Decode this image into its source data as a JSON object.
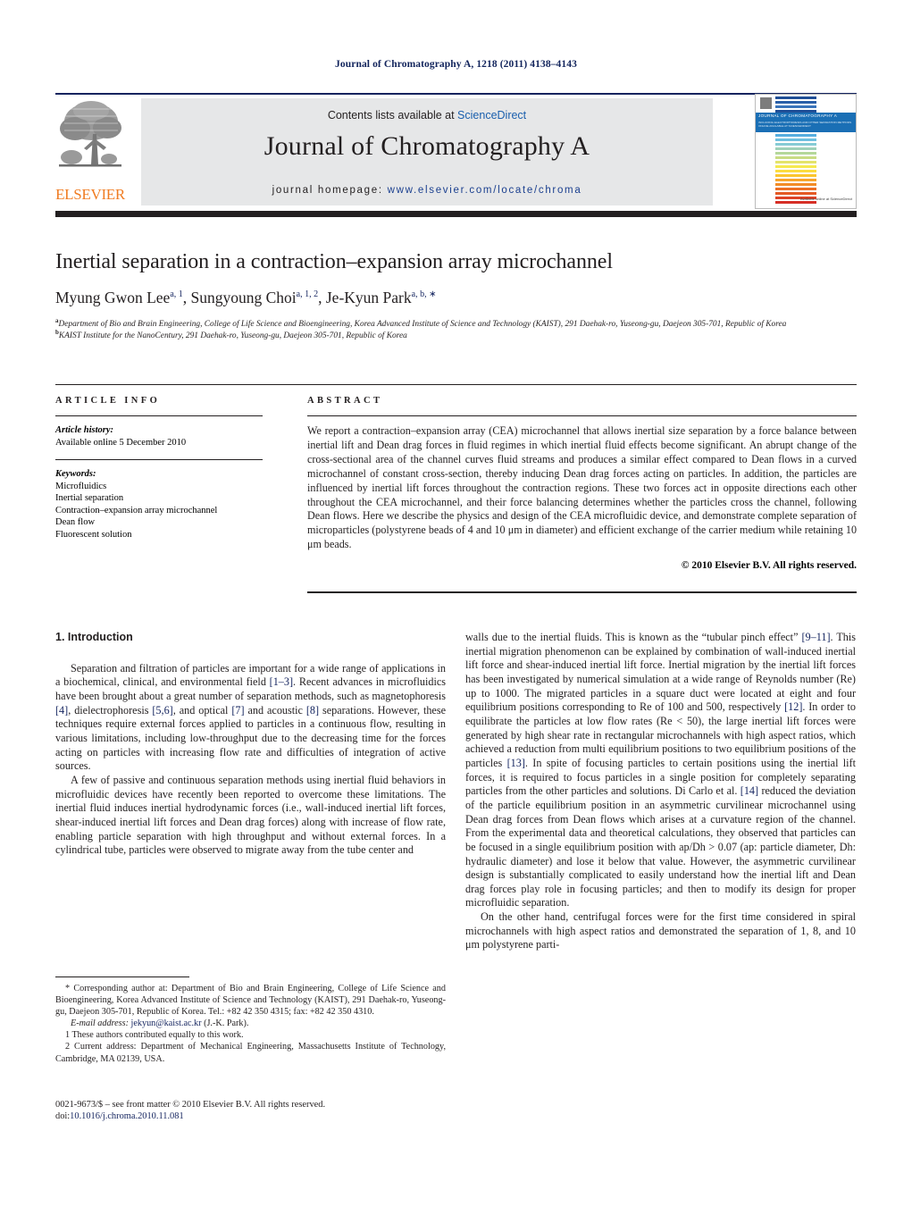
{
  "running_head": "Journal of Chromatography A, 1218 (2011) 4138–4143",
  "masthead": {
    "contents_prefix": "Contents lists available at ",
    "sciencedirect": "ScienceDirect",
    "journal_title": "Journal of Chromatography A",
    "homepage_prefix": "journal homepage: ",
    "homepage_url": "www.elsevier.com/locate/chroma",
    "publisher": "ELSEVIER",
    "cover": {
      "banner_title": "JOURNAL OF CHROMATOGRAPHY A",
      "banner_sub": "INCLUDING ELECTROPHORESIS AND OTHER SEPARATION METHODS\nONLINE AVAILABLE AT SCIENCEDIRECT",
      "sciencedirect_note": "Available online at\nScienceDirect"
    }
  },
  "title": "Inertial separation in a contraction–expansion array microchannel",
  "authors": [
    {
      "name": "Myung Gwon Lee",
      "sup": "a, 1"
    },
    {
      "name": "Sungyoung Choi",
      "sup": "a, 1, 2"
    },
    {
      "name": "Je-Kyun Park",
      "sup": "a, b, ∗"
    }
  ],
  "affiliations": [
    {
      "marker": "a",
      "text": "Department of Bio and Brain Engineering, College of Life Science and Bioengineering, Korea Advanced Institute of Science and Technology (KAIST), 291 Daehak-ro, Yuseong-gu, Daejeon 305-701, Republic of Korea"
    },
    {
      "marker": "b",
      "text": "KAIST Institute for the NanoCentury, 291 Daehak-ro, Yuseong-gu, Daejeon 305-701, Republic of Korea"
    }
  ],
  "article_info": {
    "heading": "ARTICLE INFO",
    "history_label": "Article history:",
    "history_value": "Available online 5 December 2010",
    "keywords_label": "Keywords:",
    "keywords": [
      "Microfluidics",
      "Inertial separation",
      "Contraction–expansion array microchannel",
      "Dean flow",
      "Fluorescent solution"
    ]
  },
  "abstract": {
    "heading": "ABSTRACT",
    "body": "We report a contraction–expansion array (CEA) microchannel that allows inertial size separation by a force balance between inertial lift and Dean drag forces in fluid regimes in which inertial fluid effects become significant. An abrupt change of the cross-sectional area of the channel curves fluid streams and produces a similar effect compared to Dean flows in a curved microchannel of constant cross-section, thereby inducing Dean drag forces acting on particles. In addition, the particles are influenced by inertial lift forces throughout the contraction regions. These two forces act in opposite directions each other throughout the CEA microchannel, and their force balancing determines whether the particles cross the channel, following Dean flows. Here we describe the physics and design of the CEA microfluidic device, and demonstrate complete separation of microparticles (polystyrene beads of 4 and 10 μm in diameter) and efficient exchange of the carrier medium while retaining 10 μm beads.",
    "copyright": "© 2010 Elsevier B.V. All rights reserved."
  },
  "section_heading": "1. Introduction",
  "left_column": {
    "p1_a": "Separation and filtration of particles are important for a wide range of applications in a biochemical, clinical, and environmental field ",
    "p1_c1": "[1–3]",
    "p1_b": ". Recent advances in microfluidics have been brought about a great number of separation methods, such as magnetophoresis ",
    "p1_c2": "[4]",
    "p1_c": ", dielectrophoresis ",
    "p1_c3": "[5,6]",
    "p1_d": ", and optical ",
    "p1_c4": "[7]",
    "p1_e": " and acoustic ",
    "p1_c5": "[8]",
    "p1_f": " separations. However, these techniques require external forces applied to particles in a continuous flow, resulting in various limitations, including low-throughput due to the decreasing time for the forces acting on particles with increasing flow rate and difficulties of integration of active sources.",
    "p2": "A few of passive and continuous separation methods using inertial fluid behaviors in microfluidic devices have recently been reported to overcome these limitations. The inertial fluid induces inertial hydrodynamic forces (i.e., wall-induced inertial lift forces, shear-induced inertial lift forces and Dean drag forces) along with increase of flow rate, enabling particle separation with high throughput and without external forces. In a cylindrical tube, particles were observed to migrate away from the tube center and"
  },
  "right_column": {
    "p1_a": "walls due to the inertial fluids. This is known as the “tubular pinch effect” ",
    "p1_c1": "[9–11]",
    "p1_b": ". This inertial migration phenomenon can be explained by combination of wall-induced inertial lift force and shear-induced inertial lift force. Inertial migration by the inertial lift forces has been investigated by numerical simulation at a wide range of Reynolds number (Re) up to 1000. The migrated particles in a square duct were located at eight and four equilibrium positions corresponding to Re of 100 and 500, respectively ",
    "p1_c2": "[12]",
    "p1_c": ". In order to equilibrate the particles at low flow rates (Re < 50), the large inertial lift forces were generated by high shear rate in rectangular microchannels with high aspect ratios, which achieved a reduction from multi equilibrium positions to two equilibrium positions of the particles ",
    "p1_c3": "[13]",
    "p1_d": ". In spite of focusing particles to certain positions using the inertial lift forces, it is required to focus particles in a single position for completely separating particles from the other particles and solutions. Di Carlo et al. ",
    "p1_c4": "[14]",
    "p1_e": " reduced the deviation of the particle equilibrium position in an asymmetric curvilinear microchannel using Dean drag forces from Dean flows which arises at a curvature region of the channel. From the experimental data and theoretical calculations, they observed that particles can be focused in a single equilibrium position with ap/Dh > 0.07 (ap: particle diameter, Dh: hydraulic diameter) and lose it below that value. However, the asymmetric curvilinear design is substantially complicated to easily understand how the inertial lift and Dean drag forces play role in focusing particles; and then to modify its design for proper microfluidic separation.",
    "p2": "On the other hand, centrifugal forces were for the first time considered in spiral microchannels with high aspect ratios and demonstrated the separation of 1, 8, and 10 μm polystyrene parti-"
  },
  "footnotes": {
    "corresponding": "* Corresponding author at: Department of Bio and Brain Engineering, College of Life Science and Bioengineering, Korea Advanced Institute of Science and Technology (KAIST), 291 Daehak-ro, Yuseong-gu, Daejeon 305-701, Republic of Korea. Tel.: +82 42 350 4315; fax: +82 42 350 4310.",
    "email_label": "E-mail address:",
    "email": "jekyun@kaist.ac.kr",
    "email_suffix": " (J.-K. Park).",
    "note1": "1 These authors contributed equally to this work.",
    "note2": "2 Current address: Department of Mechanical Engineering, Massachusetts Institute of Technology, Cambridge, MA 02139, USA."
  },
  "imprint": {
    "issn_line": "0021-9673/$ – see front matter © 2010 Elsevier B.V. All rights reserved.",
    "doi_label": "doi:",
    "doi_value": "10.1016/j.chroma.2010.11.081"
  },
  "colors": {
    "journal_blue": "#14245f",
    "link_blue": "#1a5fad",
    "elsevier_orange": "#f07c22",
    "rule_black": "#231f20",
    "masthead_grey": "#e6e7e8"
  }
}
